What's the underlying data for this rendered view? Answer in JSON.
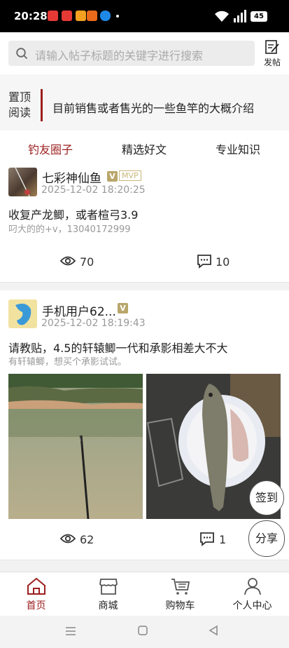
{
  "status_bar": {
    "time": "20:28",
    "battery": "45"
  },
  "search": {
    "placeholder": "请输入帖子标题的关键字进行搜索"
  },
  "post_button": {
    "label": "发帖"
  },
  "notice": {
    "tag_line1": "置顶",
    "tag_line2": "阅读",
    "text": "目前销售或者售光的一些鱼竿的大概介绍"
  },
  "tabs": [
    {
      "label": "钓友圈子",
      "active": true
    },
    {
      "label": "精选好文",
      "active": false
    },
    {
      "label": "专业知识",
      "active": false
    }
  ],
  "posts": [
    {
      "username": "七彩神仙鱼",
      "v_badge": "V",
      "mvp_badge": "MVP",
      "time": "2025-12-02 18:20:25",
      "title": "收复产龙鲫，或者楦弓3.9",
      "subtitle": "叼大的的+v，13040172999",
      "views": "70",
      "comments": "10"
    },
    {
      "username": "手机用户62...",
      "v_badge": "V",
      "time": "2025-12-02 18:19:43",
      "title": "请教贴，4.5的轩辕鲫一代和承影相差大不大",
      "subtitle": "有轩辕鲫，想买个承影试试。",
      "views": "62",
      "comments": "1"
    }
  ],
  "float_buttons": {
    "signin": "签到",
    "share": "分享"
  },
  "bottom_nav": [
    {
      "label": "首页",
      "icon": "home-icon",
      "active": true
    },
    {
      "label": "商城",
      "icon": "shop-icon",
      "active": false
    },
    {
      "label": "购物车",
      "icon": "cart-icon",
      "active": false
    },
    {
      "label": "个人中心",
      "icon": "person-icon",
      "active": false
    }
  ],
  "colors": {
    "accent": "#9c1e1e",
    "badge": "#b9a66a"
  }
}
